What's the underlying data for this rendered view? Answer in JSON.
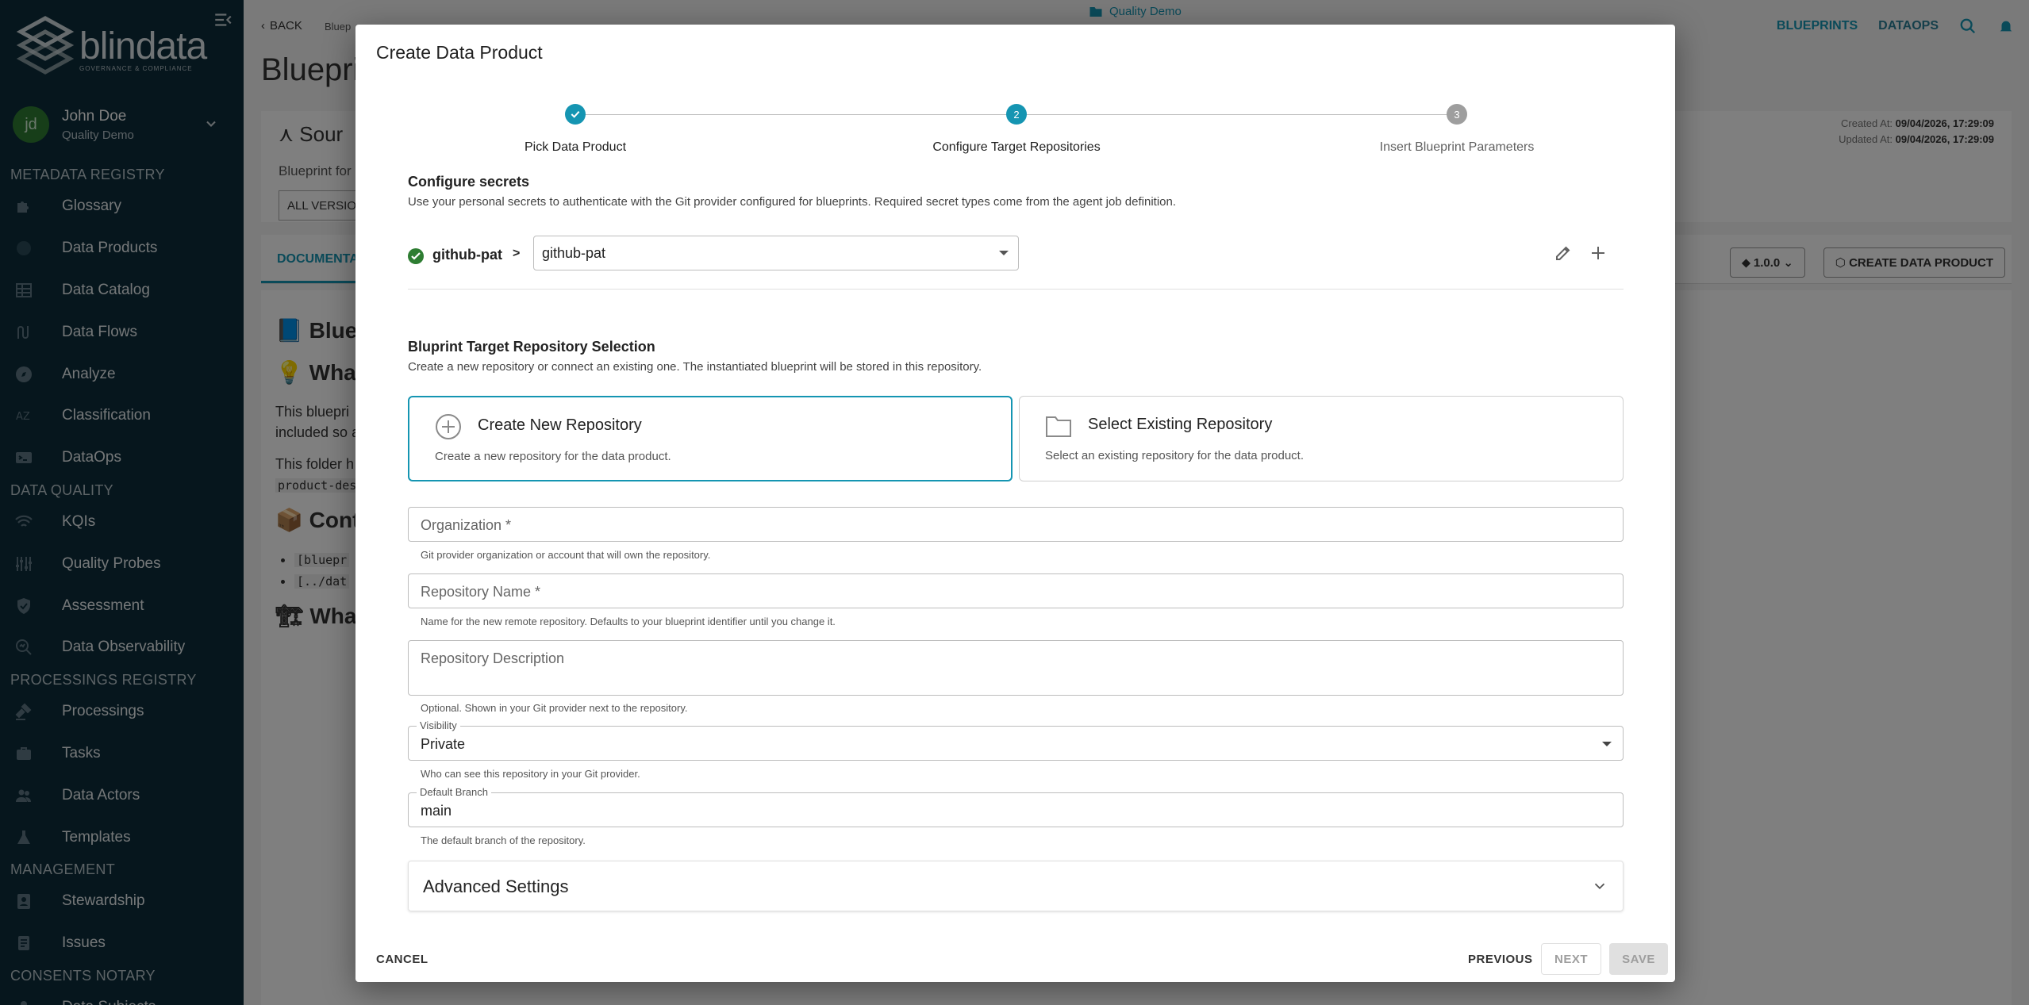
{
  "sidebar": {
    "logo_word": "blindata",
    "logo_sub": "GOVERNANCE & COMPLIANCE",
    "user": {
      "initials": "jd",
      "name": "John Doe",
      "tenant": "Quality Demo"
    },
    "sections": [
      {
        "title": "METADATA REGISTRY",
        "items": [
          "Glossary",
          "Data Products",
          "Data Catalog",
          "Data Flows",
          "Analyze",
          "Classification",
          "DataOps"
        ]
      },
      {
        "title": "DATA QUALITY",
        "items": [
          "KQIs",
          "Quality Probes",
          "Assessment",
          "Data Observability"
        ]
      },
      {
        "title": "PROCESSINGS REGISTRY",
        "items": [
          "Processings",
          "Tasks",
          "Data Actors",
          "Templates"
        ]
      },
      {
        "title": "MANAGEMENT",
        "items": [
          "Stewardship",
          "Issues"
        ]
      },
      {
        "title": "CONSENTS NOTARY",
        "items": [
          "Data Subjects"
        ]
      }
    ]
  },
  "page": {
    "back_label": "BACK",
    "crumb_tail": "Bluep",
    "tenant_badge": "Quality Demo",
    "nav_blueprints": "BLUEPRINTS",
    "nav_dataops": "DATAOPS",
    "title": "Bluepri",
    "source_title": "Sour",
    "source_sub": "Blueprint for",
    "all_versions": "ALL VERSIO",
    "created_at_label": "Created At:",
    "created_at": "09/04/2026, 17:29:09",
    "updated_at_label": "Updated At:",
    "updated_at": "09/04/2026, 17:29:09",
    "doc_tab": "DOCUMENTA",
    "version": "1.0.0",
    "create_dp": "CREATE DATA PRODUCT"
  },
  "modal": {
    "title": "Create Data Product",
    "steps": [
      {
        "label": "Pick Data Product",
        "state": "done"
      },
      {
        "label": "Configure Target Repositories",
        "num": "2",
        "state": "active"
      },
      {
        "label": "Insert Blueprint Parameters",
        "num": "3",
        "state": "pending"
      }
    ],
    "secrets": {
      "title": "Configure secrets",
      "desc": "Use your personal secrets to authenticate with the Git provider configured for blueprints. Required secret types come from the agent job definition.",
      "name": "github-pat",
      "arrow": ">",
      "value": "github-pat"
    },
    "repo": {
      "title": "Bluprint Target Repository Selection",
      "desc": "Create a new repository or connect an existing one. The instantiated blueprint will be stored in this repository.",
      "create_title": "Create New Repository",
      "create_desc": "Create a new repository for the data product.",
      "select_title": "Select Existing Repository",
      "select_desc": "Select an existing repository for the data product."
    },
    "fields": {
      "org_placeholder": "Organization *",
      "org_helper": "Git provider organization or account that will own the repository.",
      "name_placeholder": "Repository Name *",
      "name_helper": "Name for the new remote repository. Defaults to your blueprint identifier until you change it.",
      "desc_placeholder": "Repository Description",
      "desc_helper": "Optional. Shown in your Git provider next to the repository.",
      "visibility_label": "Visibility",
      "visibility_value": "Private",
      "visibility_helper": "Who can see this repository in your Git provider.",
      "branch_label": "Default Branch",
      "branch_value": "main",
      "branch_helper": "The default branch of the repository."
    },
    "advanced": "Advanced Settings",
    "cancel": "CANCEL",
    "previous": "PREVIOUS",
    "next": "NEXT",
    "save": "SAVE"
  },
  "colors": {
    "accent": "#1595b2",
    "sidebar": "#0d2d3a",
    "success": "#2e7d32"
  }
}
